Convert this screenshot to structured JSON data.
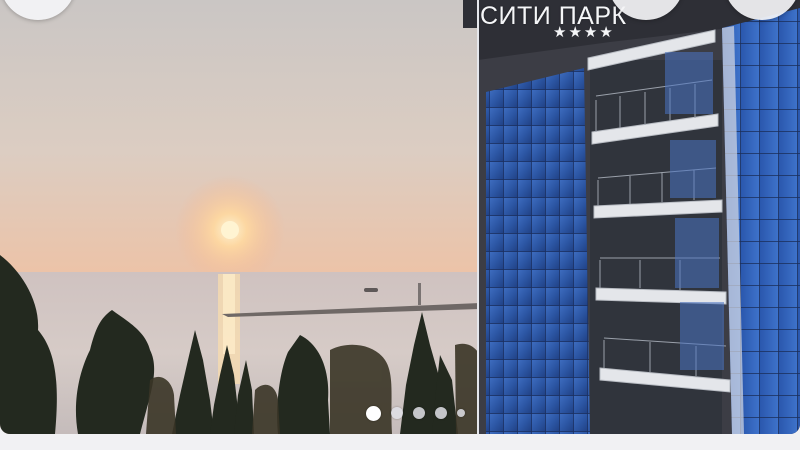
{
  "gallery": {
    "photo": "hotel-sunset-sea-view",
    "hotel_sign_text": "СИТИ ПАРК",
    "hotel_stars": "★★★★",
    "slide_count": 5,
    "active_slide": 1
  },
  "buttons": {
    "back_icon": "back-icon",
    "share_icon": "share-icon",
    "favorite_icon": "heart-icon"
  },
  "colors": {
    "page_background": "#f1f1f3",
    "facade_glass": "#2f5aa8",
    "sky_top": "#c7c3c3",
    "sky_horizon": "#f1b897"
  }
}
